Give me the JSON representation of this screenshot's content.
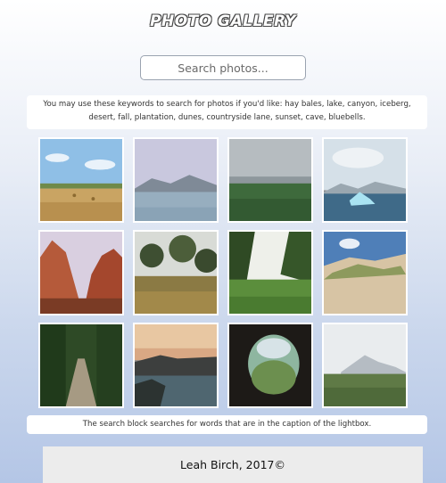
{
  "header": {
    "title": "PHOTO GALLERY"
  },
  "search": {
    "placeholder": "Search photos..."
  },
  "keywords_note": "You may use these keywords to search for photos if you'd like: hay bales, lake, canyon, iceberg, desert, fall, plantation, dunes, countryside lane, sunset, cave, bluebells.",
  "search_note": "The search block searches for words that are in the caption of the lightbox.",
  "footer": {
    "text": "Leah Birch, 2017©"
  },
  "gallery": {
    "photos": [
      {
        "name": "hay-bales-photo"
      },
      {
        "name": "lake-photo"
      },
      {
        "name": "canyon-photo"
      },
      {
        "name": "iceberg-photo"
      },
      {
        "name": "desert-photo"
      },
      {
        "name": "fall-photo"
      },
      {
        "name": "plantation-photo"
      },
      {
        "name": "dunes-photo"
      },
      {
        "name": "countryside-lane-photo"
      },
      {
        "name": "sunset-photo"
      },
      {
        "name": "cave-photo"
      },
      {
        "name": "bluebells-photo"
      }
    ]
  }
}
